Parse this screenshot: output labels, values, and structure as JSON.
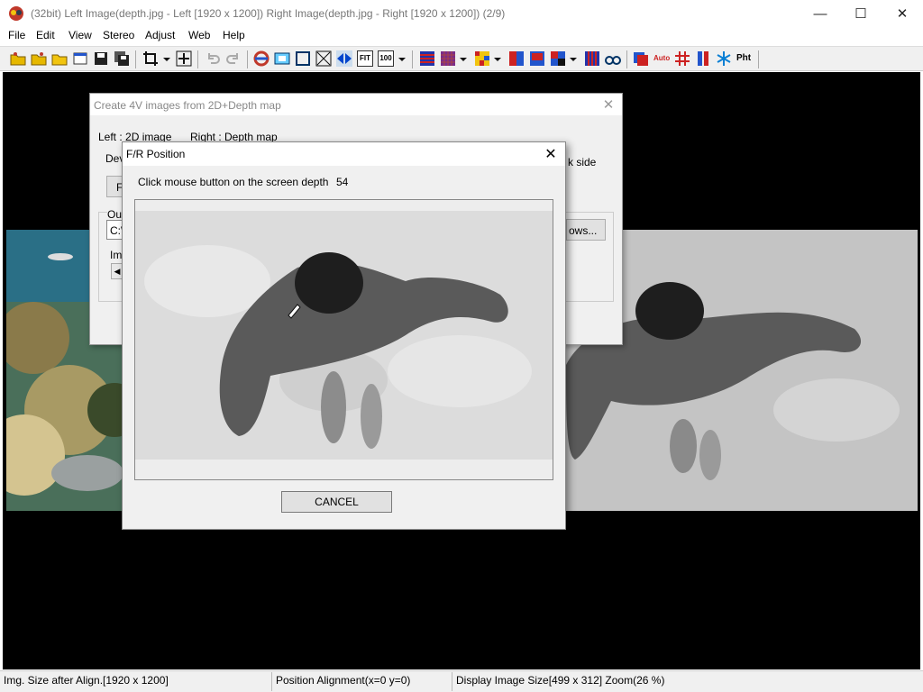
{
  "window": {
    "title": "(32bit) Left Image(depth.jpg - Left [1920 x 1200]) Right Image(depth.jpg - Right [1920 x 1200])  (2/9)",
    "minimize": "—",
    "maximize": "☐",
    "close": "✕"
  },
  "menu": [
    "File",
    "Edit",
    "View",
    "Stereo",
    "Adjust",
    "Web",
    "Help"
  ],
  "toolbar": {
    "fit_label": "FIT",
    "zoom100_label": "100",
    "auto_label": "Auto",
    "pht_label": "Pht"
  },
  "dialog4v": {
    "title": "Create 4V images from 2D+Depth map",
    "left_label": "Left : 2D image",
    "right_label": "Right : Depth map",
    "dev_label": "Dev",
    "side_label": "k side",
    "f_button": "F",
    "output_group": "Out",
    "path_value": "C:\\",
    "ima_label": "Ima",
    "browse_button": "ows...",
    "close": "✕"
  },
  "fr_dialog": {
    "title": "F/R Position",
    "close": "✕",
    "instruction": "Click mouse button on the screen depth",
    "depth_value": "54",
    "cancel": "CANCEL"
  },
  "status": {
    "img_size": "Img. Size after Align.[1920 x 1200]",
    "position": "Position Alignment(x=0 y=0)",
    "display": "Display Image Size[499 x 312]  Zoom(26 %)"
  },
  "icons": [
    "app-icon",
    "open-folder-icon",
    "save-icon",
    "floppy-icon",
    "crop-icon",
    "move-icon",
    "undo-icon",
    "redo-icon",
    "swap-icon",
    "fit-icon",
    "flip-icon",
    "dropper-icon"
  ]
}
